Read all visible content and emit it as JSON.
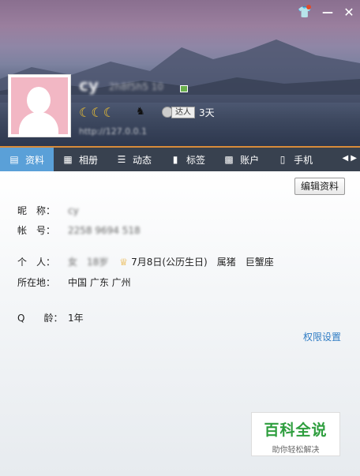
{
  "header": {
    "nickname": "cy",
    "signature": "2h8f5h5 10",
    "levels": "☾☾☾",
    "daren_label": "达人",
    "days": "3天",
    "url": "http://127.0.0.1"
  },
  "tabs": [
    {
      "label": "资料",
      "icon": "id-card-icon"
    },
    {
      "label": "相册",
      "icon": "photo-icon"
    },
    {
      "label": "动态",
      "icon": "list-icon"
    },
    {
      "label": "标签",
      "icon": "bookmark-icon"
    },
    {
      "label": "账户",
      "icon": "briefcase-icon"
    },
    {
      "label": "手机",
      "icon": "phone-icon"
    }
  ],
  "content": {
    "edit_button": "编辑资料",
    "nickname_label": "昵　称：",
    "nickname_value": "cy",
    "account_label": "帐　号：",
    "account_value": "2258 9694 518",
    "personal_label": "个　人：",
    "personal_gender": "女",
    "personal_age": "18岁",
    "birthday": "7月8日(公历生日)",
    "zodiac": "属猪",
    "constellation": "巨蟹座",
    "location_label": "所在地：",
    "location_value": "中国 广东 广州",
    "qage_label": "Q　　龄：",
    "qage_value": "1年",
    "permission_link": "权限设置"
  },
  "watermark": {
    "title": "百科全说",
    "subtitle": "助你轻松解决"
  }
}
